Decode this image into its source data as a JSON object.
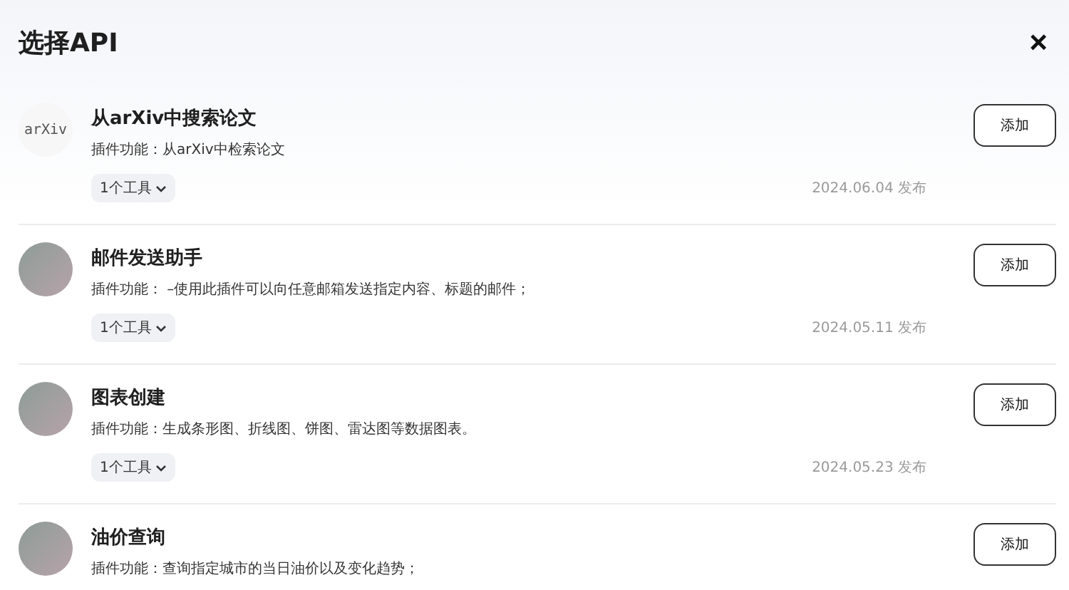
{
  "dialog": {
    "title": "选择API",
    "close": "×"
  },
  "plugins": [
    {
      "avatar": {
        "kind": "logo",
        "text": "arXiv"
      },
      "name": "从arXiv中搜索论文",
      "description": "插件功能：从arXiv中检索论文",
      "tools": "1个工具",
      "date": "2024.06.04 发布",
      "button": "添加"
    },
    {
      "avatar": {
        "kind": "image"
      },
      "name": "邮件发送助手",
      "description": "插件功能： –使用此插件可以向任意邮箱发送指定内容、标题的邮件；",
      "tools": "1个工具",
      "date": "2024.05.11 发布",
      "button": "添加"
    },
    {
      "avatar": {
        "kind": "image"
      },
      "name": "图表创建",
      "description": "插件功能：生成条形图、折线图、饼图、雷达图等数据图表。",
      "tools": "1个工具",
      "date": "2024.05.23 发布",
      "button": "添加"
    },
    {
      "avatar": {
        "kind": "image"
      },
      "name": "油价查询",
      "description": "插件功能：查询指定城市的当日油价以及变化趋势；",
      "button": "添加"
    }
  ]
}
